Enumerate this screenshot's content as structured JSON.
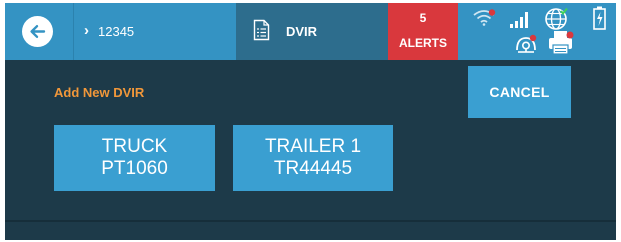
{
  "header": {
    "vehicle_id": "12345",
    "module_label": "DVIR",
    "alerts": {
      "count": "5",
      "label": "ALERTS"
    }
  },
  "icons": {
    "back": "arrow-left-icon",
    "chevron": "chevron-right-icon",
    "dvir": "document-icon",
    "wifi": "wifi-icon",
    "signal": "signal-bars-icon",
    "globe": "globe-icon",
    "battery": "battery-icon",
    "gps": "gps-icon",
    "printer": "printer-icon"
  },
  "page": {
    "title": "Add New DVIR",
    "cancel_label": "CANCEL"
  },
  "vehicles": [
    {
      "type": "TRUCK",
      "id": "PT1060"
    },
    {
      "type": "TRAILER 1",
      "id": "TR44445"
    }
  ],
  "colors": {
    "background": "#1d3a49",
    "accent": "#3493c3",
    "button": "#3a9fd1",
    "alert": "#d9383d",
    "title": "#f0973a"
  }
}
